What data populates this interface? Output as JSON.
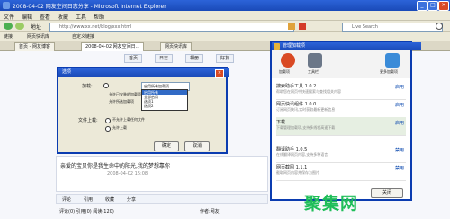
{
  "window": {
    "title": "2008-04-02 网友空间日志分享 - Microsoft Internet Explorer"
  },
  "menu": {
    "items": [
      "文件",
      "编辑",
      "查看",
      "收藏",
      "工具",
      "帮助"
    ]
  },
  "address": {
    "label": "地址",
    "value": "http://www.xx.net/blog/xxx.html"
  },
  "search": {
    "placeholder": "Live Search"
  },
  "links": {
    "items": [
      "链接",
      "网页快讯库",
      "自定义链接"
    ]
  },
  "tabs": [
    {
      "label": "首页 - 网友博客"
    },
    {
      "label": "2008-04-02 网友空间日..."
    },
    {
      "label": "网页快讯库"
    }
  ],
  "page_tabs": {
    "items": [
      "首页",
      "日志",
      "相册",
      "好友"
    ]
  },
  "dialog": {
    "title": "选项",
    "row1_label": "加载:",
    "row1_value": "启用所有加载项",
    "option_a": "允许已安装的加载项",
    "option_b": "允许所选加载项",
    "list_options": [
      "启用所有",
      "全部启用",
      "选项1",
      "选项2"
    ],
    "row2_label": "文件上载:",
    "radio1": "不允许上载任何文件",
    "radio2": "允许上载",
    "ok": "确定",
    "cancel": "取消"
  },
  "article": {
    "title": "亲爱的宝贝你是我生命中的阳光,我的梦想靠你",
    "date": "2008-04-02 15:08",
    "toolbar": [
      "评论",
      "引用",
      "收藏",
      "分享"
    ],
    "footer_left": "评论(0) 引用(0) 阅读(120)",
    "footer_right": "作者:网友"
  },
  "panel": {
    "title": "管理加载项",
    "icons": [
      {
        "label": "加载项"
      },
      {
        "label": "工具栏"
      },
      {
        "label": "更多加载项"
      }
    ],
    "items": [
      {
        "name": "搜索助手工具 1.0.2",
        "desc": "帮助您在网页中快速搜索与查找相关内容",
        "action": "启用"
      },
      {
        "name": "网页快讯组件 1.0.0",
        "desc": "订阅网页快讯,实时获取最新更新信息",
        "action": "启用"
      },
      {
        "name": "下载",
        "desc": "下载管理加载项,支持多线程高速下载",
        "action": "启用"
      },
      {
        "name": "翻译助手 1.0.5",
        "desc": "在线翻译网页内容,支持多种语言",
        "action": "禁用"
      },
      {
        "name": "网页截图 1.1.1",
        "desc": "截取网页内容并保存为图片",
        "action": "禁用"
      }
    ],
    "close": "关闭"
  },
  "watermark": "聚集网",
  "colors": {
    "titlebar": "#1a4ab8",
    "accent": "#2c63d8",
    "watermark": "#1fbe59"
  }
}
